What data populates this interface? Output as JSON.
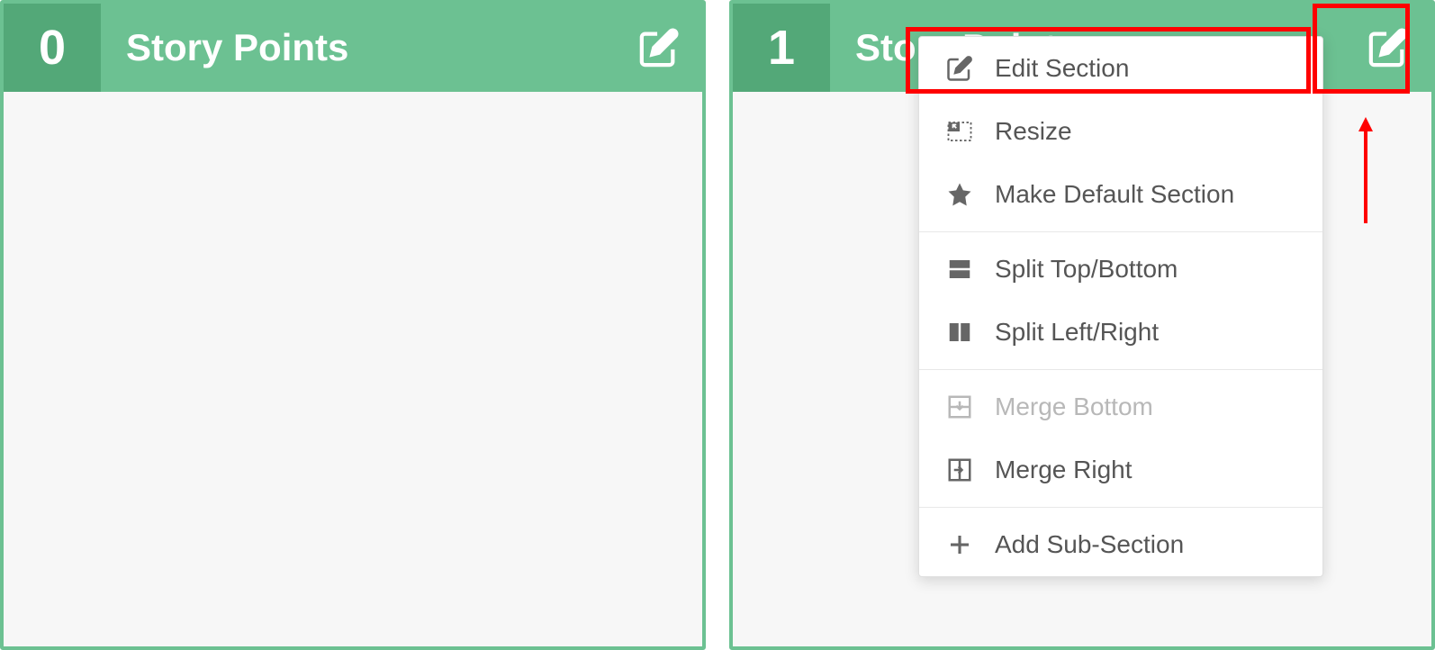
{
  "panels": [
    {
      "number": "0",
      "title": "Story Points"
    },
    {
      "number": "1",
      "title": "Story Points"
    }
  ],
  "menu": {
    "edit_section": "Edit Section",
    "resize": "Resize",
    "make_default": "Make Default Section",
    "split_top_bottom": "Split Top/Bottom",
    "split_left_right": "Split Left/Right",
    "merge_bottom": "Merge Bottom",
    "merge_right": "Merge Right",
    "add_sub_section": "Add Sub-Section"
  },
  "colors": {
    "accent": "#6cc192",
    "accent_dark": "#53a878",
    "highlight": "#ff0000"
  }
}
